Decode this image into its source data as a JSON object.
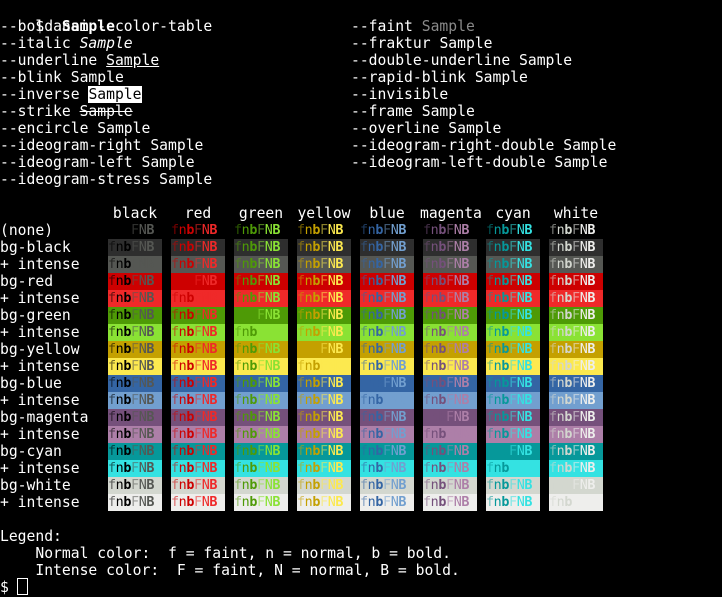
{
  "prompt": {
    "symbol": "$",
    "command": "ansi --color-table"
  },
  "attributes_left": [
    {
      "flag": "--bold",
      "sample": "Sample",
      "style": "b"
    },
    {
      "flag": "--italic",
      "sample": "Sample",
      "style": "it"
    },
    {
      "flag": "--underline",
      "sample": "Sample",
      "style": "ul"
    },
    {
      "flag": "--blink",
      "sample": "Sample",
      "style": ""
    },
    {
      "flag": "--inverse",
      "sample": "Sample",
      "style": "inv"
    },
    {
      "flag": "--strike",
      "sample": "Sample",
      "style": "st"
    },
    {
      "flag": "--encircle",
      "sample": "Sample",
      "style": ""
    },
    {
      "flag": "--ideogram-right",
      "sample": "Sample",
      "style": ""
    },
    {
      "flag": "--ideogram-left",
      "sample": "Sample",
      "style": ""
    },
    {
      "flag": "--ideogram-stress",
      "sample": "Sample",
      "style": ""
    }
  ],
  "attributes_right": [
    {
      "flag": "--faint",
      "sample": "Sample",
      "style": "fa"
    },
    {
      "flag": "--fraktur",
      "sample": "Sample",
      "style": ""
    },
    {
      "flag": "--double-underline",
      "sample": "Sample",
      "style": ""
    },
    {
      "flag": "--rapid-blink",
      "sample": "Sample",
      "style": ""
    },
    {
      "flag": "--invisible",
      "sample": "",
      "style": ""
    },
    {
      "flag": "--frame",
      "sample": "Sample",
      "style": ""
    },
    {
      "flag": "--overline",
      "sample": "Sample",
      "style": ""
    },
    {
      "flag": "--ideogram-right-double",
      "sample": "Sample",
      "style": ""
    },
    {
      "flag": "--ideogram-left-double",
      "sample": "Sample",
      "style": ""
    }
  ],
  "table": {
    "columns": [
      "black",
      "red",
      "green",
      "yellow",
      "blue",
      "magenta",
      "cyan",
      "white"
    ],
    "sample_text": "fnbFNB",
    "rows": [
      "(none)",
      "bg-black",
      "+ intense",
      "bg-red",
      "+ intense",
      "bg-green",
      "+ intense",
      "bg-yellow",
      "+ intense",
      "bg-blue",
      "+ intense",
      "bg-magenta",
      "+ intense",
      "bg-cyan",
      "+ intense",
      "bg-white",
      "+ intense"
    ]
  },
  "colors": {
    "normal": [
      "#000000",
      "#cd0000",
      "#4e9a06",
      "#c4a000",
      "#3465a4",
      "#75507b",
      "#06989a",
      "#d3d7cf"
    ],
    "intense": [
      "#555753",
      "#ef2929",
      "#8ae234",
      "#fce94f",
      "#729fcf",
      "#ad7fa8",
      "#34e2e2",
      "#eeeeec"
    ],
    "row_bg": [
      "#000000",
      "#2e2e2e",
      "#555753",
      "#cd0000",
      "#ef2929",
      "#4e9a06",
      "#8ae234",
      "#c4a000",
      "#fce94f",
      "#3465a4",
      "#729fcf",
      "#75507b",
      "#ad7fa8",
      "#06989a",
      "#34e2e2",
      "#d3d7cf",
      "#eeeeec"
    ]
  },
  "legend": {
    "title": "Legend:",
    "normal": "    Normal color:  f = faint, n = normal, b = bold.",
    "intense": "    Intense color:  F = faint, N = normal, B = bold."
  },
  "final_prompt": "$"
}
